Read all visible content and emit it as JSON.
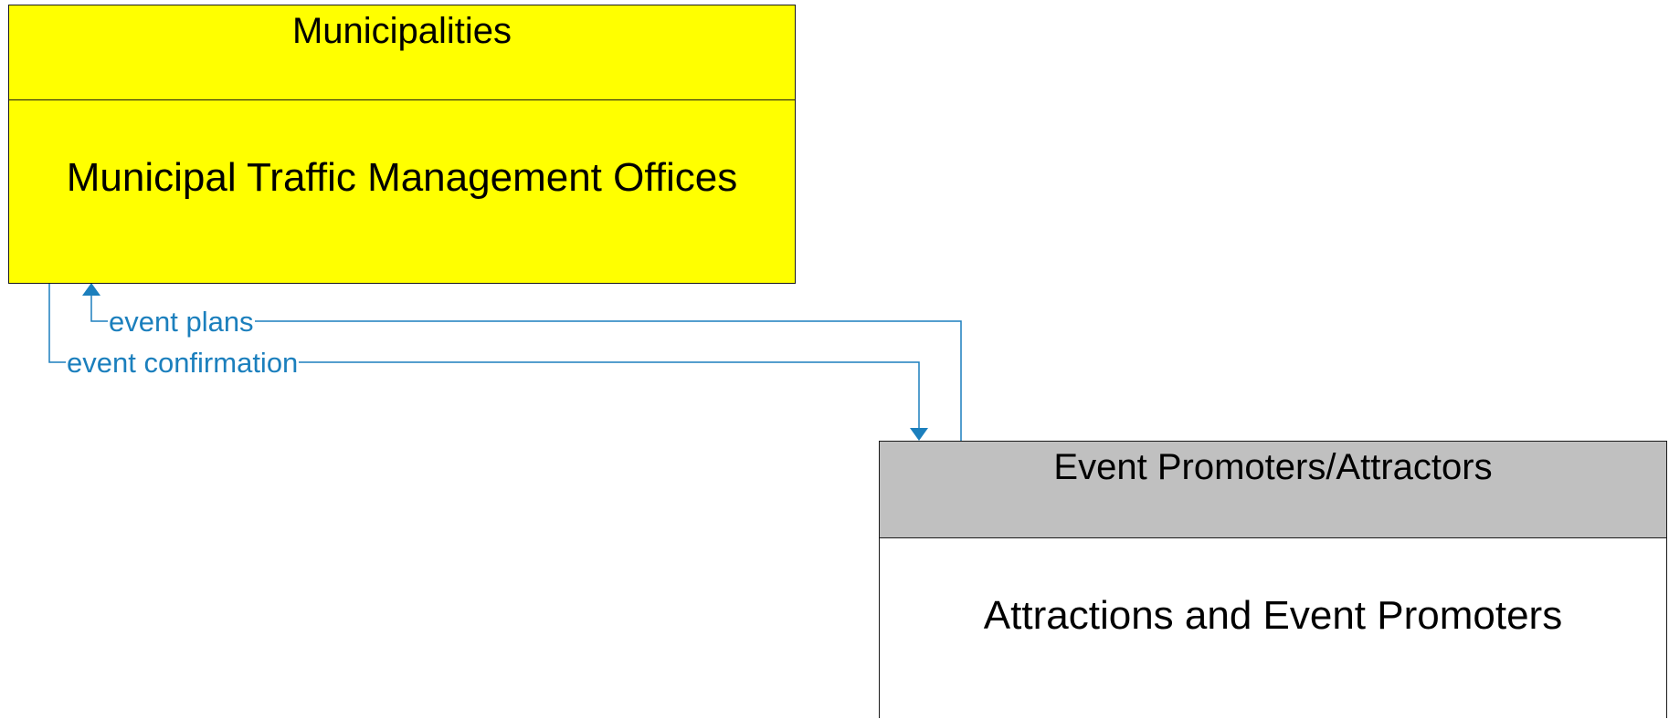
{
  "diagram": {
    "nodes": [
      {
        "id": "municipalities",
        "group": "Municipalities",
        "element": "Municipal Traffic Management Offices",
        "header_color": "#ffff00",
        "body_color": "#ffff00"
      },
      {
        "id": "event_promoters",
        "group": "Event Promoters/Attractors",
        "element": "Attractions and Event Promoters",
        "header_color": "#c0c0c0",
        "body_color": "#ffffff"
      }
    ],
    "flows": [
      {
        "label": "event plans",
        "from": "Attractions and Event Promoters",
        "to": "Municipal Traffic Management Offices"
      },
      {
        "label": "event confirmation",
        "from": "Municipal Traffic Management Offices",
        "to": "Attractions and Event Promoters"
      }
    ],
    "flow_color": "#1b7fbd"
  }
}
